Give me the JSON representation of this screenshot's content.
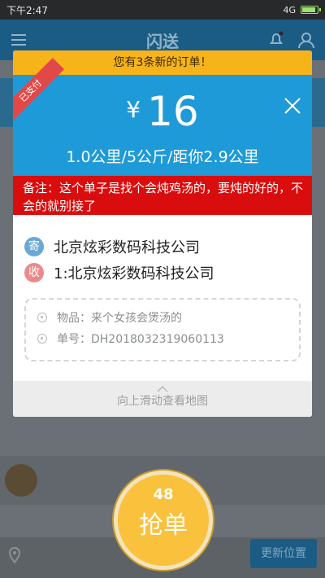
{
  "status_bar": {
    "time": "下午2:47",
    "network": "4G",
    "battery_level": 0.95
  },
  "app_header": {
    "title": "闪送"
  },
  "order_card": {
    "notice": "您有3条新的订单！",
    "paid_badge": "已支付",
    "currency_symbol": "¥",
    "price": "16",
    "distance_info": "1.0公里/5公斤/距你2.9公里",
    "remark": "备注：这个单子是找个会炖鸡汤的，要炖的好的，不会的就别接了",
    "sender_tag": "寄",
    "sender": "北京炫彩数码科技公司",
    "receiver_tag": "收",
    "receiver": "1:北京炫彩数码科技公司",
    "goods_line": "物品：来个女孩会煲汤的",
    "order_no_line": "单号：DH2018032319060113",
    "slide_hint": "向上滑动查看地图"
  },
  "grab_button": {
    "count": "48",
    "label": "抢单"
  },
  "background_bottom": {
    "update_button": "更新位置"
  },
  "colors": {
    "notice": "#f7b31a",
    "price_bg": "#1e9ad8",
    "remark_bg": "#d90d0d",
    "grab_button": "#fac13c"
  }
}
